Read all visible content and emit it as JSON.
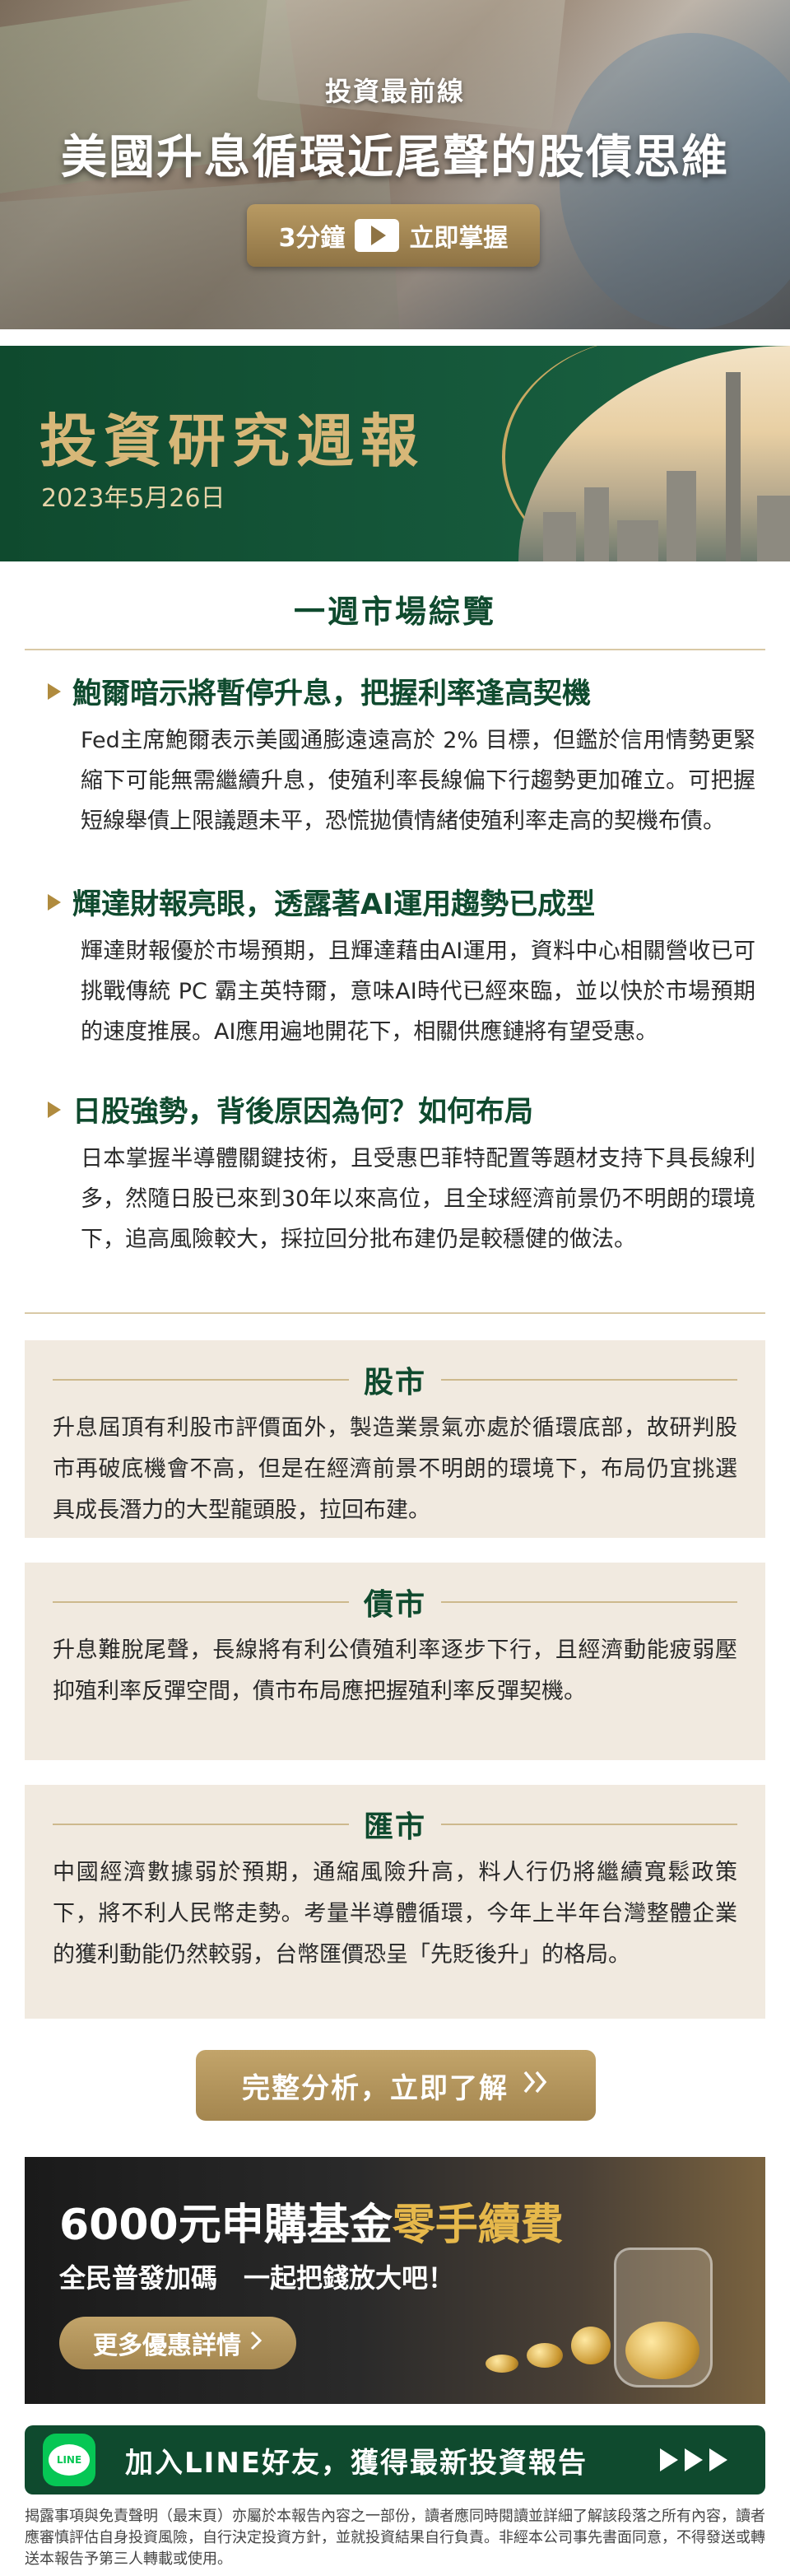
{
  "hero": {
    "kicker": "投資最前線",
    "title": "美國升息循環近尾聲的股債思維",
    "cta_prefix": "3分鐘",
    "cta_suffix": "立即掌握"
  },
  "weekly": {
    "title": "投資研究週報",
    "date": "2023年5月26日"
  },
  "overview": {
    "title": "一週市場綜覽",
    "topics": [
      {
        "heading": "鮑爾暗示將暫停升息，把握利率逢高契機",
        "body": "Fed主席鮑爾表示美國通膨遠遠高於 2% 目標，但鑑於信用情勢更緊縮下可能無需繼續升息，使殖利率長線偏下行趨勢更加確立。可把握短線舉債上限議題未平，恐慌拋債情緒使殖利率走高的契機布債。"
      },
      {
        "heading": "輝達財報亮眼，透露著AI運用趨勢已成型",
        "body": "輝達財報優於市場預期，且輝達藉由AI運用，資料中心相關營收已可挑戰傳統 PC 霸主英特爾，意味AI時代已經來臨，並以快於市場預期的速度推展。AI應用遍地開花下，相關供應鏈將有望受惠。"
      },
      {
        "heading": "日股強勢，背後原因為何？如何布局",
        "body": "日本掌握半導體關鍵技術，且受惠巴菲特配置等題材支持下具長線利多，然隨日股已來到30年以來高位，且全球經濟前景仍不明朗的環境下，追高風險較大，採拉回分批布建仍是較穩健的做法。"
      }
    ]
  },
  "sections": [
    {
      "title": "股市",
      "body": "升息屆頂有利股市評價面外，製造業景氣亦處於循環底部，故研判股市再破底機會不高，但是在經濟前景不明朗的環境下，布局仍宜挑選具成長潛力的大型龍頭股，拉回布建。"
    },
    {
      "title": "債市",
      "body": "升息難脫尾聲，長線將有利公債殖利率逐步下行，且經濟動能疲弱壓抑殖利率反彈空間，債市布局應把握殖利率反彈契機。"
    },
    {
      "title": "匯市",
      "body": "中國經濟數據弱於預期，通縮風險升高，料人行仍將繼續寬鬆政策下，將不利人民幣走勢。考量半導體循環，今年上半年台灣整體企業的獲利動能仍然較弱，台幣匯價恐呈「先貶後升」的格局。"
    }
  ],
  "analysis_button": "完整分析，立即了解",
  "promo": {
    "title_main": "6000元申購基金",
    "title_accent": "零手續費",
    "subtitle": "全民普發加碼　一起把錢放大吧！",
    "button": "更多優惠詳情"
  },
  "line_bar": {
    "logo_text": "LINE",
    "text": "加入LINE好友，獲得最新投資報告"
  },
  "disclaimer": "揭露事項與免責聲明（最末頁）亦屬於本報告內容之一部份，讀者應同時閱讀並詳細了解該段落之所有內容，讀者應審慎評估自身投資風險，自行決定投資方針，並就投資結果自行負責。非經本公司事先書面同意，不得發送或轉送本報告予第三人轉載或使用。",
  "colors": {
    "brand_green": "#0f4a2e",
    "gold": "#b08b3e",
    "section_bg": "#f1eae0",
    "line_green": "#06c755"
  }
}
